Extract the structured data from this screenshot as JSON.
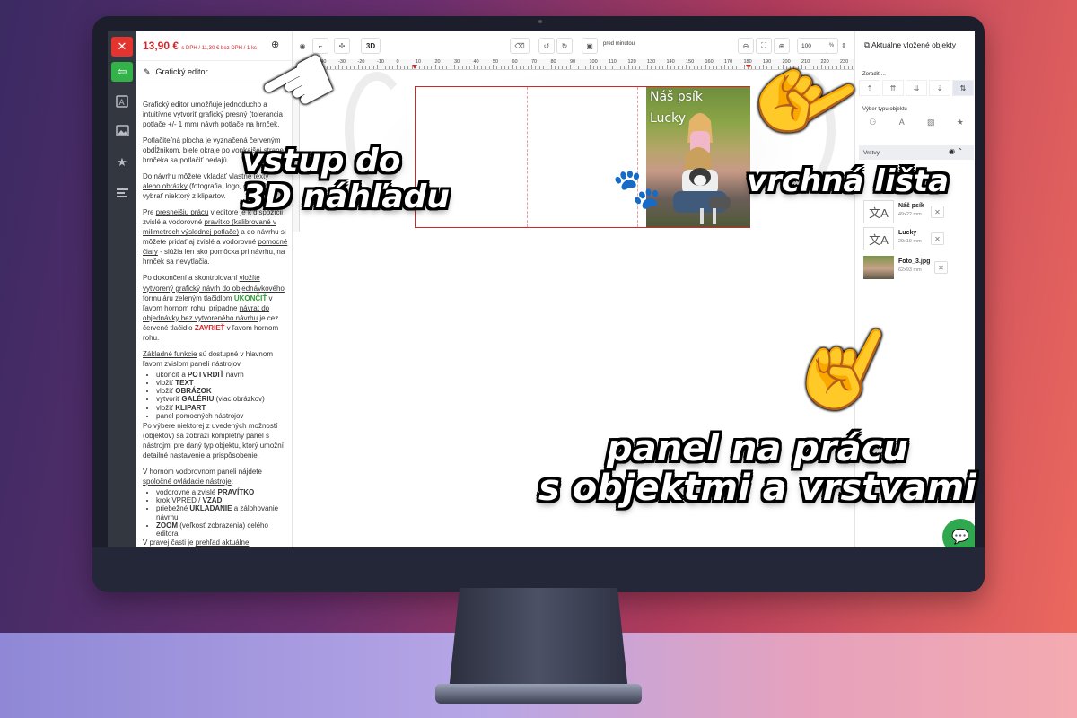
{
  "price": {
    "with_vat": "13,90 €",
    "with_vat_suffix": "s DPH",
    "without_vat": " / 11,30 € bez DPH / 1 ks"
  },
  "rail": {
    "close_label": "✕",
    "back_label": "⇦"
  },
  "info": {
    "header": "Grafický editor",
    "p1": "Grafický editor umožňuje jednoducho a intuitívne vytvoriť grafický presný (tolerancia potlače +/- 1 mm) návrh potlače na hrnček.",
    "p2_u": "Potlačiteľná plocha",
    "p2": " je vyznačená červeným obdĺžnikom, biele okraje po vonkajšej strane hrnčeka sa potlačiť nedajú.",
    "p3_a": "Do návrhu môžete ",
    "p3_u1": "vkladať vlastné texty",
    "p3_b": " ",
    "p3_u2": "alebo obrázky",
    "p3_c": " (fotografia, logo, grafika) alebo vybrať niektorý z klipartov.",
    "p4_a": "Pre ",
    "p4_u1": "presnejšiu prácu",
    "p4_b": " v editore je k dispozícii zvislé a vodorovné ",
    "p4_u2": "pravítko (kalibrované v milimetroch výslednej potlače)",
    "p4_c": " a do návrhu si môžete pridať aj zvislé a vodorovné ",
    "p4_u3": "pomocné čiary",
    "p4_d": " - slúžia len ako pomôcka pri návrhu, na hrnček sa nevytlačia.",
    "p5_a": "Po dokončení a skontrolovaní ",
    "p5_u1": "vložíte vytvorený grafický návrh do objednávkového formuláru",
    "p5_b": " zeleným tlačidlom ",
    "p5_g": "UKONČIŤ",
    "p5_c": " v ľavom hornom rohu, prípadne ",
    "p5_u2": "návrat do objednávky bez vytvoreného návrhu",
    "p5_d": " je cez červené tlačidlo ",
    "p5_r": "ZAVRIEŤ",
    "p5_e": " v ľavom hornom rohu.",
    "p6_u": "Základné funkcie",
    "p6": " sú dostupné v hlavnom ľavom zvislom paneli nástrojov",
    "list1": [
      {
        "pre": "ukončiť a ",
        "b": "POTVRDIŤ",
        "post": " návrh"
      },
      {
        "pre": "vložiť ",
        "b": "TEXT",
        "post": ""
      },
      {
        "pre": "vložiť ",
        "b": "OBRÁZOK",
        "post": ""
      },
      {
        "pre": "vytvoriť ",
        "b": "GALÉRIU",
        "post": " (viac obrázkov)"
      },
      {
        "pre": "vložiť ",
        "b": "KLIPART",
        "post": ""
      },
      {
        "pre": "panel pomocných nástrojov",
        "b": "",
        "post": ""
      }
    ],
    "p7": "Po výbere niektorej z uvedených možností (objektov) sa zobrazí kompletný panel s nástrojmi pre daný typ objektu, ktorý umožní detailné nastavenie a prispôsobenie.",
    "p8_a": "V hornom vodorovnom paneli nájdete ",
    "p8_u": "spoločné ovládacie nástroje",
    "p8_b": ":",
    "list2": [
      {
        "pre": "vodorovné a zvislé ",
        "b": "PRAVÍTKO",
        "post": ""
      },
      {
        "pre": "krok VPRED / ",
        "b": "VZAD",
        "post": ""
      },
      {
        "pre": "priebežné ",
        "b": "UKLADANIE",
        "post": " a zálohovanie návrhu"
      },
      {
        "pre": "",
        "b": "ZOOM",
        "post": " (veľkosť zobrazenia) celého editora"
      }
    ],
    "p9_a": "V pravej časti je ",
    "p9_u": "prehľad aktuálne"
  },
  "toolbar": {
    "btn_3d": "3D",
    "saved_time": "pred minútou",
    "zoom_value": "100",
    "zoom_unit": "%"
  },
  "ruler": {
    "ticks": [
      "-50",
      "-40",
      "-30",
      "-20",
      "-10",
      "0",
      "10",
      "20",
      "30",
      "40",
      "50",
      "60",
      "70",
      "80",
      "90",
      "100",
      "110",
      "120",
      "130",
      "140",
      "150",
      "160",
      "170",
      "180",
      "190",
      "200",
      "210",
      "220",
      "230"
    ]
  },
  "design": {
    "text1": "Náš psík",
    "text2": "Lucky"
  },
  "right_panel": {
    "title": "Aktuálne vložené objekty",
    "sort_label": "Zoradiť ...",
    "type_label": "Výber typu objektu",
    "layers_label": "Vrstvy",
    "layers": [
      {
        "name": "Náš psík",
        "size": "49x22 mm",
        "icon": "translate-icon"
      },
      {
        "name": "Lucky",
        "size": "29x19 mm",
        "icon": "translate-icon"
      },
      {
        "name": "Foto_3.jpg",
        "size": "62x93 mm",
        "icon": "image-thumb"
      }
    ]
  },
  "annotations": {
    "a1_line1": "vstup do",
    "a1_line2": "3D náhľadu",
    "a2": "vrchná lišta",
    "a3_line1": "panel na prácu",
    "a3_line2": "s objektmi a vrstvami"
  },
  "colors": {
    "accent_red": "#d0262a",
    "accent_green": "#2f9e35",
    "rail_dark": "#33373f"
  }
}
